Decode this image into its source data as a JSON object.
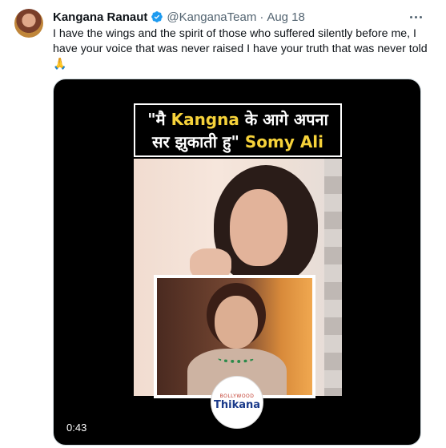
{
  "tweet": {
    "author_name": "Kangana Ranaut",
    "handle": "@KanganaTeam",
    "separator": "·",
    "date": "Aug 18",
    "text": "I have the wings and the spirit of those who suffered silently before me, I have your voice that was never raised I have your truth that was never told",
    "emoji": "🙏"
  },
  "media": {
    "headline_line1_prefix": "\"मै ",
    "headline_line1_highlight": "Kangna",
    "headline_line1_suffix": " के आगे अपना",
    "headline_line2_prefix": "सर झुकाती हु\" ",
    "headline_line2_highlight": "Somy Ali",
    "logo_small": "BOLLYWOOD",
    "logo_big": "Thikana",
    "video_timestamp": "0:43"
  },
  "icons": {
    "verified": "verified-badge-icon",
    "more": "more-options-icon"
  },
  "colors": {
    "verified_blue": "#1d9bf0",
    "headline_highlight": "#f6d23a",
    "secondary_text": "#536471"
  }
}
